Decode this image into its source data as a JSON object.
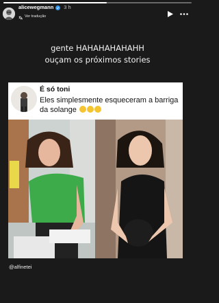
{
  "story": {
    "progress": 0.55
  },
  "header": {
    "username": "alicewegmann",
    "time": "3 h",
    "translate_label": "Ver tradução",
    "icons": [
      "avatar",
      "verified-icon",
      "translate-icon",
      "play-icon",
      "more-icon"
    ]
  },
  "caption": {
    "line1": "gente HAHAHAHAHAHH",
    "line2": "ouçam os próximos stories"
  },
  "tweet": {
    "name": "É só toni",
    "text": "Eles simplesmente esqueceram a barriga da solange"
  },
  "mention": "@alfinetei",
  "colors": {
    "background": "#1a1a1a",
    "verified": "#3897f0",
    "card": "#ffffff"
  }
}
